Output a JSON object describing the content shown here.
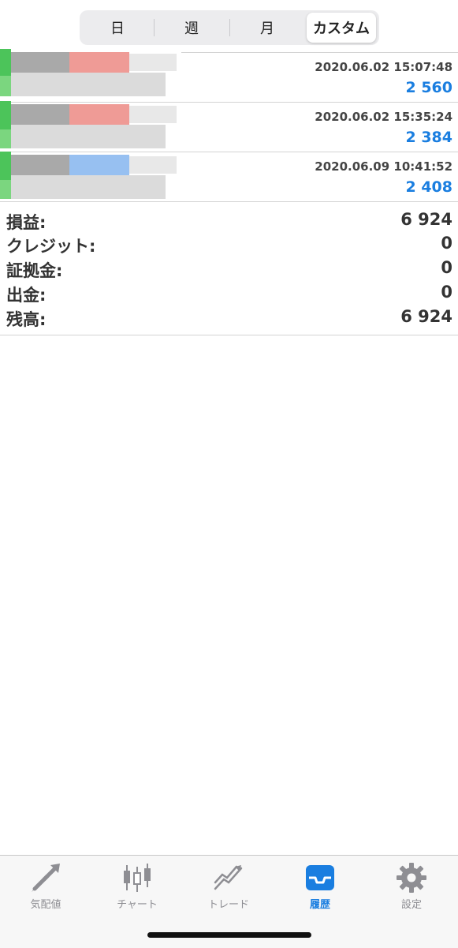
{
  "segments": [
    "日",
    "週",
    "月",
    "カスタム"
  ],
  "active_segment": "カスタム",
  "deals": [
    {
      "time": "2020.06.02 15:07:48",
      "profit": "2 560"
    },
    {
      "time": "2020.06.02 15:35:24",
      "profit": "2 384"
    },
    {
      "time": "2020.06.09 10:41:52",
      "profit": "2 408"
    }
  ],
  "summary": [
    {
      "label": "損益:",
      "value": "6 924"
    },
    {
      "label": "クレジット:",
      "value": "0"
    },
    {
      "label": "証拠金:",
      "value": "0"
    },
    {
      "label": "出金:",
      "value": "0"
    },
    {
      "label": "残高:",
      "value": "6 924"
    }
  ],
  "tabbar": {
    "items": [
      {
        "label": "気配値",
        "icon": "quotes-arrows-icon"
      },
      {
        "label": "チャート",
        "icon": "candlestick-icon"
      },
      {
        "label": "トレード",
        "icon": "trade-chart-icon"
      },
      {
        "label": "履歴",
        "icon": "history-inbox-icon"
      },
      {
        "label": "設定",
        "icon": "gear-icon"
      }
    ],
    "active": "履歴"
  },
  "colors": {
    "accent": "#1a7ee0",
    "profit": "#1a7ee0",
    "divider": "#d4d4d4"
  }
}
